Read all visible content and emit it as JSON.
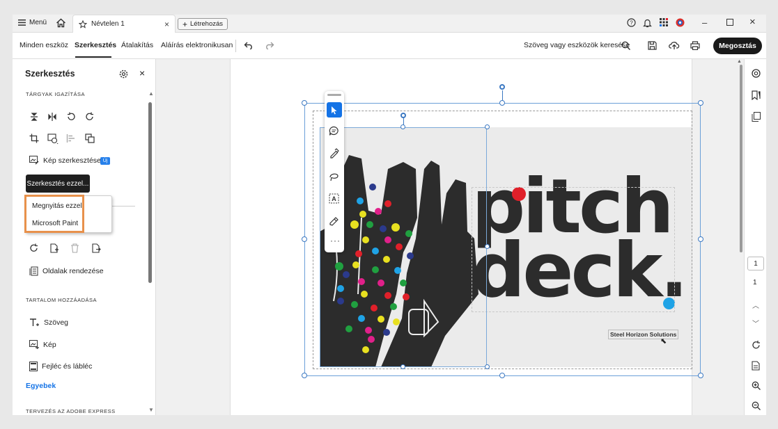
{
  "titlebar": {
    "menu_label": "Menü",
    "tab_title": "Névtelen 1",
    "create_label": "Létrehozás"
  },
  "toolbar": {
    "tabs": [
      "Minden eszköz",
      "Szerkesztés",
      "Átalakítás",
      "Aláírás elektronikusan"
    ],
    "active_tab": "Szerkesztés",
    "search_label": "Szöveg vagy eszközök keresése",
    "share_label": "Megosztás"
  },
  "panel": {
    "title": "Szerkesztés",
    "section_adjust": "TÁRGYAK IGAZÍTÁSA",
    "edit_image_label": "Kép szerkesztése",
    "new_badge": "Új",
    "edit_with_label": "Szerkesztés ezzel...",
    "dropdown_items": [
      "Megnyitás ezzel",
      "Microsoft Paint"
    ],
    "arrange_pages_label": "Oldalak rendezése",
    "section_add": "TARTALOM HOZZÁADÁSA",
    "text_label": "Szöveg",
    "image_label": "Kép",
    "header_footer_label": "Fejléc és lábléc",
    "other_label": "Egyebek",
    "section_design": "TERVEZÉS AZ ADOBE EXPRESS"
  },
  "canvas": {
    "headline_line1": "pitch",
    "headline_line2": "deck.",
    "company_label": "Steel Horizon Solutions"
  },
  "rightrail": {
    "page_current": "1",
    "page_total": "1"
  },
  "colors": {
    "accent_blue": "#1473e6",
    "highlight_orange": "#e8914b",
    "dot_red": "#e0202a",
    "dot_cyan": "#1fa3e6"
  }
}
